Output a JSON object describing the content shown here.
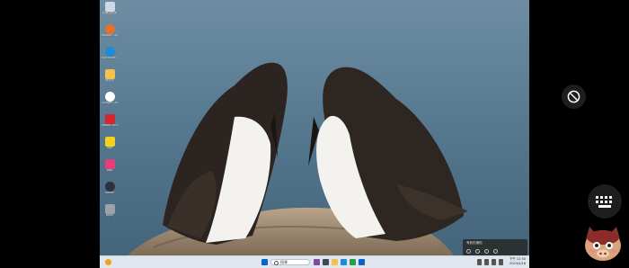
{
  "desktop": {
    "icons": [
      {
        "name": "recycle-bin",
        "label": "資源回收筒",
        "color": "#cfd9e3"
      },
      {
        "name": "app-orange",
        "label": "Ubisoft Connect",
        "color": "#e8702a"
      },
      {
        "name": "edge",
        "label": "Microsoft Edge",
        "color": "#1f8bd6"
      },
      {
        "name": "folder",
        "label": "資料夾",
        "color": "#f2c14e"
      },
      {
        "name": "chrome",
        "label": "Google Chrome",
        "color": "#ffffff"
      },
      {
        "name": "pdf",
        "label": "Adobe Acrobat",
        "color": "#d7262b"
      },
      {
        "name": "app-yellow",
        "label": "App",
        "color": "#f3d21b"
      },
      {
        "name": "app-pink",
        "label": "App",
        "color": "#e83e7d"
      },
      {
        "name": "app-dark",
        "label": "Steam",
        "color": "#2b3340"
      },
      {
        "name": "app-grey",
        "label": "Apps",
        "color": "#9aa3ab"
      }
    ]
  },
  "taskbar": {
    "search_label": "搜尋",
    "clock_time": "下午 12:30",
    "clock_date": "2024/4/16"
  },
  "notification": {
    "text": "有新的通知"
  },
  "colors": {
    "accent": "#0a64c8",
    "sea": "#5b7d95"
  }
}
